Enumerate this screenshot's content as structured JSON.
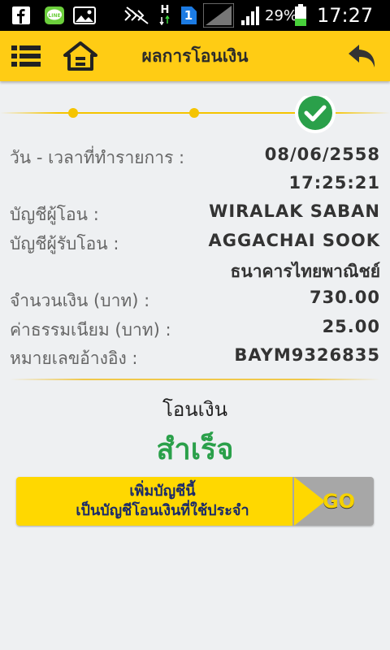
{
  "status_bar": {
    "battery_percent": "29%",
    "time": "17:27",
    "network_type": "H",
    "sim_slot": "1",
    "icons": [
      "facebook-icon",
      "line-icon",
      "gallery-icon",
      "mute-icon",
      "data-arrows-icon",
      "sim-icon",
      "signal-icon",
      "battery-icon"
    ]
  },
  "header": {
    "title": "ผลการโอนเงิน",
    "icons": [
      "menu-icon",
      "home-icon",
      "back-icon"
    ]
  },
  "progress": {
    "steps": 3,
    "current_step": 3,
    "complete_color": "#2aa04a",
    "accent": "#f5c400"
  },
  "transaction": {
    "date_label": "วัน - เวลาที่ทำรายการ :",
    "date_value": "08/06/2558",
    "time_value": "17:25:21",
    "from_label": "บัญชีผู้โอน :",
    "from_value": "WIRALAK SABAN",
    "to_label": "บัญชีผู้รับโอน :",
    "to_name": "AGGACHAI SOOK",
    "to_bank": "ธนาคารไทยพาณิชย์",
    "amount_label": "จำนวนเงิน (บาท) :",
    "amount_value": "730.00",
    "fee_label": "ค่าธรรมเนียม (บาท) :",
    "fee_value": "25.00",
    "ref_label": "หมายเลขอ้างอิง :",
    "ref_value": "BAYM9326835"
  },
  "result": {
    "title": "โอนเงิน",
    "status": "สำเร็จ",
    "status_color": "#2aa04a"
  },
  "banner": {
    "line1": "เพิ่มบัญชีนี้",
    "line2": "เป็นบัญชีโอนเงินที่ใช้ประจำ",
    "go_label": "GO"
  }
}
